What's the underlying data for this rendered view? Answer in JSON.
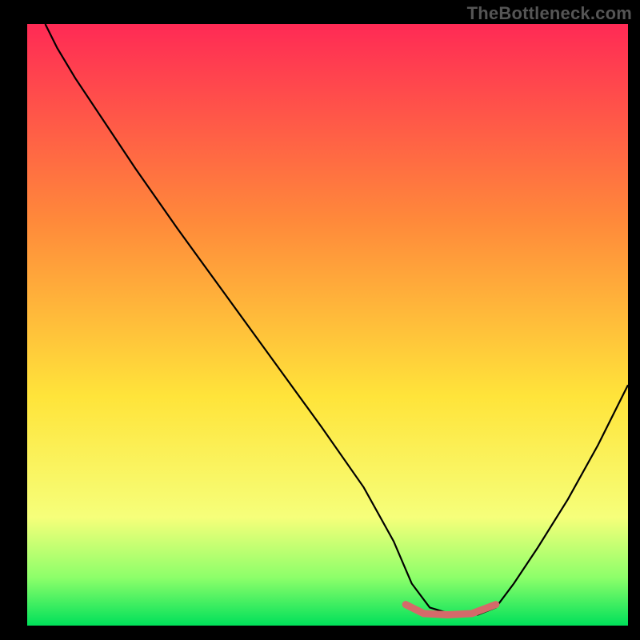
{
  "watermark": "TheBottleneck.com",
  "colors": {
    "background": "#000000",
    "gradient_top": "#ff2a55",
    "gradient_mid1": "#ff8a3a",
    "gradient_mid2": "#ffe43a",
    "gradient_bot1": "#f6ff7a",
    "gradient_bot2": "#8dff6a",
    "gradient_bottom": "#00e05a",
    "curve": "#000000",
    "marker": "#d46a6a"
  },
  "chart_data": {
    "type": "line",
    "title": "",
    "xlabel": "",
    "ylabel": "",
    "xlim": [
      0,
      100
    ],
    "ylim": [
      0,
      100
    ],
    "note": "Abstract bottleneck curve: y=100 is top of gradient, y=0 is bottom (green). Curve descends from upper-left toward a flat minimum in the 63–78 x-range, then rises toward the right.",
    "series": [
      {
        "name": "bottleneck-curve",
        "x": [
          3,
          5,
          8,
          12,
          18,
          25,
          33,
          41,
          49,
          56,
          61,
          64,
          67,
          71,
          75,
          78,
          81,
          85,
          90,
          95,
          100
        ],
        "y": [
          100,
          96,
          91,
          85,
          76,
          66,
          55,
          44,
          33,
          23,
          14,
          7,
          3,
          1.8,
          1.8,
          3,
          7,
          13,
          21,
          30,
          40
        ]
      },
      {
        "name": "optimal-marker",
        "x": [
          63,
          66,
          70,
          74,
          78
        ],
        "y": [
          3.5,
          2,
          1.8,
          2,
          3.5
        ]
      }
    ]
  }
}
